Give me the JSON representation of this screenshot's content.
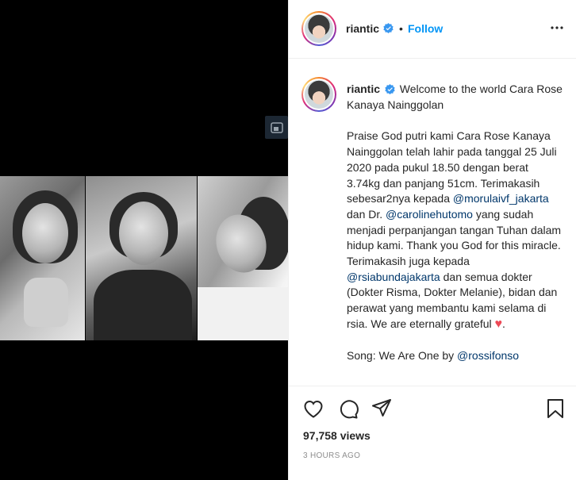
{
  "post": {
    "username": "riantic",
    "follow_label": "Follow",
    "separator": "•",
    "caption": {
      "title": "Welcome to the world Cara Rose Kanaya Nainggolan",
      "p1_a": "Praise God putri kami Cara Rose Kanaya Nainggolan telah lahir pada tanggal 25 Juli 2020 pada pukul 18.50 dengan berat 3.74kg dan panjang 51cm. Terimakasih sebesar2nya kepada ",
      "mention1": "@morulaivf_jakarta",
      "p1_b": " dan Dr. ",
      "mention2": "@carolinehutomo",
      "p1_c": " yang sudah menjadi perpanjangan tangan Tuhan dalam hidup kami. Thank you God for this miracle. Terimakasih juga kepada ",
      "mention3": "@rsiabundajakarta",
      "p1_d": " dan semua dokter (Dokter Risma, Dokter Melanie), bidan dan perawat yang membantu kami selama di rsia. We are eternally grateful ",
      "heart": "♥",
      "p1_e": ".",
      "song_prefix": "Song: We Are One by ",
      "song_mention": "@rossifonso"
    },
    "views": "97,758 views",
    "time": "3 HOURS AGO"
  },
  "icons": {
    "verified": "verified-badge-icon",
    "more": "more-options-icon",
    "like": "heart-icon",
    "comment": "comment-icon",
    "share": "share-icon",
    "save": "bookmark-icon",
    "media": "video-media-icon"
  },
  "colors": {
    "follow": "#0095f6",
    "verified": "#3897f0",
    "mention": "#00376b",
    "heart": "#ed4956",
    "timestamp": "#8e8e8e"
  }
}
